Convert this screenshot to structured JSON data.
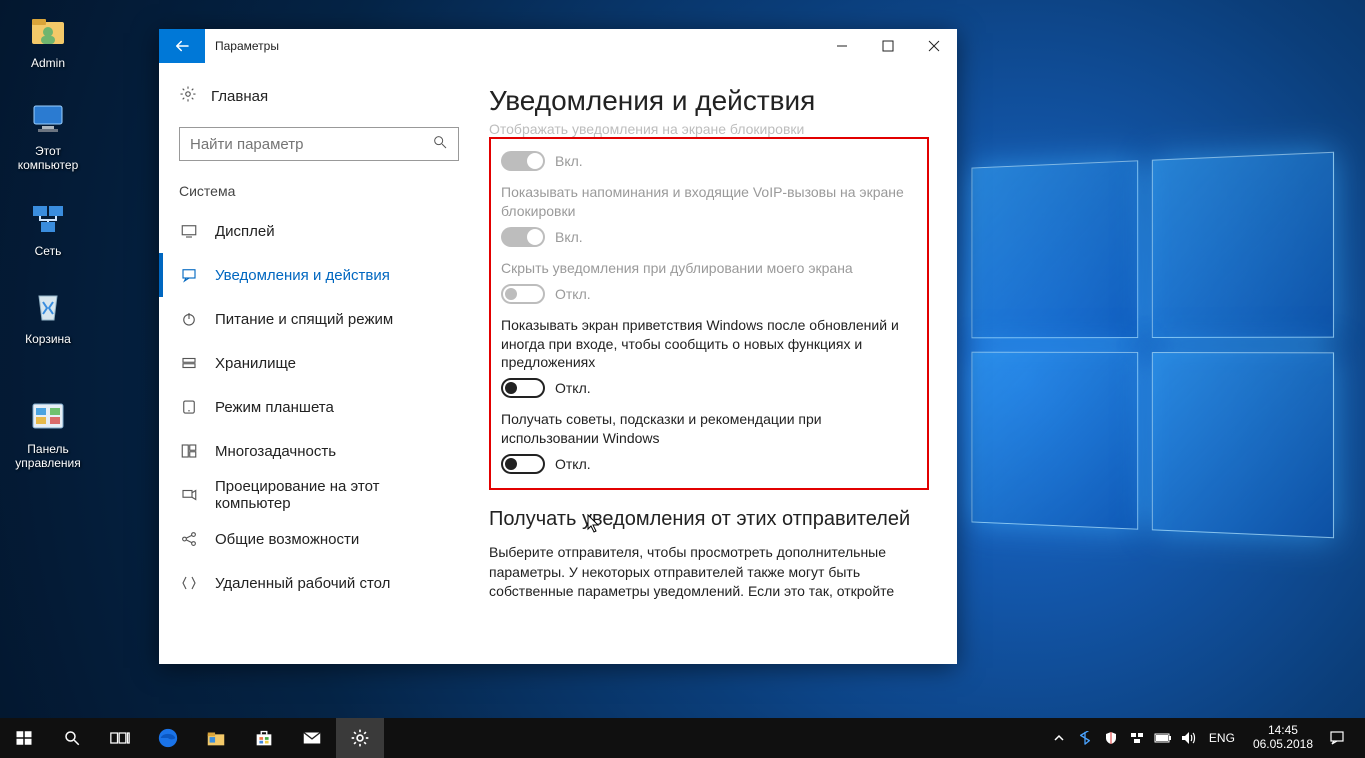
{
  "desktop_icons": [
    {
      "label": "Admin"
    },
    {
      "label": "Этот компьютер"
    },
    {
      "label": "Сеть"
    },
    {
      "label": "Корзина"
    },
    {
      "label": "Панель управления"
    }
  ],
  "window": {
    "title": "Параметры",
    "home": "Главная",
    "search_placeholder": "Найти параметр",
    "group": "Система",
    "nav": [
      "Дисплей",
      "Уведомления и действия",
      "Питание и спящий режим",
      "Хранилище",
      "Режим планшета",
      "Многозадачность",
      "Проецирование на этот компьютер",
      "Общие возможности",
      "Удаленный рабочий стол"
    ],
    "page_title": "Уведомления и действия",
    "cut_top": "Отображать уведомления на экране блокировки",
    "opts": [
      {
        "label": "",
        "state": "on-dis",
        "state_text": "Вкл."
      },
      {
        "label": "Показывать напоминания и входящие VoIP-вызовы на экране блокировки",
        "state": "on-dis",
        "state_text": "Вкл."
      },
      {
        "label": "Скрыть уведомления при дублировании моего экрана",
        "state": "off-dis",
        "state_text": "Откл."
      },
      {
        "label": "Показывать экран приветствия Windows после обновлений и иногда при входе, чтобы сообщить о новых функциях и предложениях",
        "state": "off",
        "state_text": "Откл."
      },
      {
        "label": "Получать советы, подсказки и рекомендации при использовании Windows",
        "state": "off",
        "state_text": "Откл."
      }
    ],
    "section_title": "Получать уведомления от этих отправителей",
    "section_body": "Выберите отправителя, чтобы просмотреть дополнительные параметры. У некоторых отправителей также могут быть собственные параметры уведомлений. Если это так, откройте"
  },
  "taskbar": {
    "lang": "ENG",
    "time": "14:45",
    "date": "06.05.2018"
  }
}
